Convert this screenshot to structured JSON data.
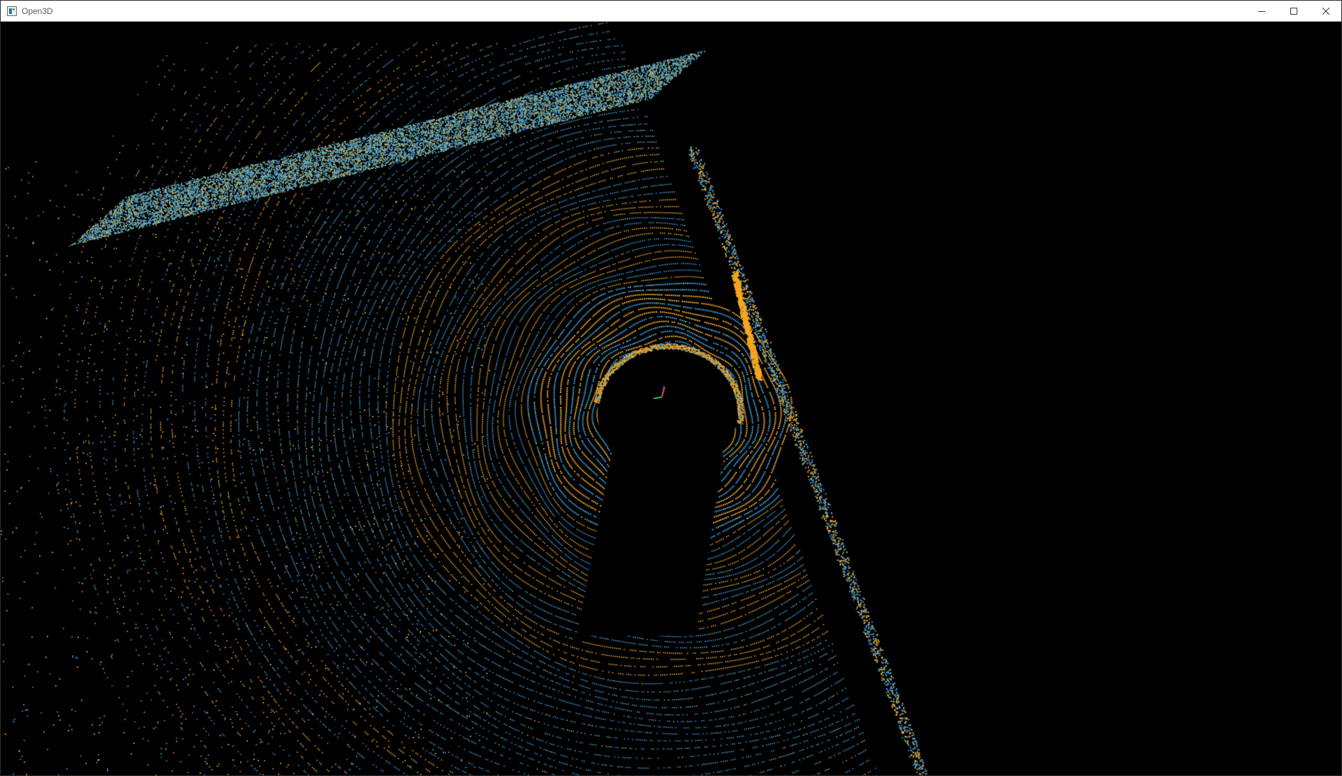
{
  "window": {
    "title": "Open3D",
    "app_icon": "open3d-app-icon",
    "controls": {
      "minimize_icon": "minimize-icon",
      "maximize_icon": "maximize-icon",
      "close_icon": "close-icon"
    }
  },
  "viewport": {
    "background_color": "#000000",
    "content": "point-cloud",
    "point_colors": {
      "primary": "#f5a623",
      "secondary": "#3a9ad9",
      "blend": "#a9b27a"
    },
    "axis_colors": {
      "x": "#e03030",
      "y": "#30c040",
      "z": "#3050e0"
    }
  }
}
